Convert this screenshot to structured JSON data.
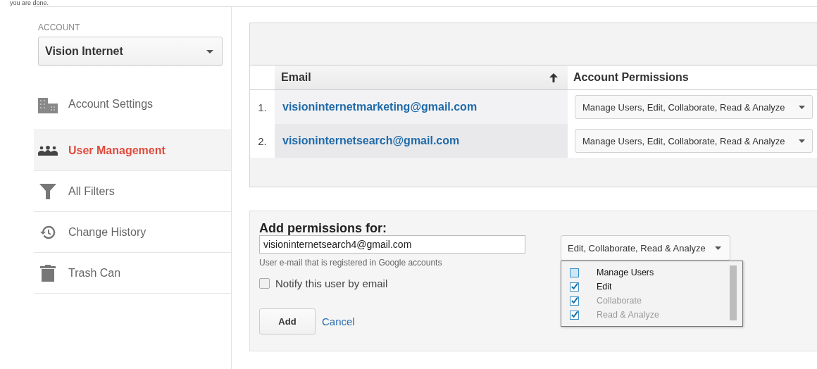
{
  "top_note": "you are done.",
  "sidebar": {
    "account_label": "ACCOUNT",
    "account": "Vision Internet",
    "items": [
      {
        "label": "Account Settings",
        "kind": "building",
        "selected": false
      },
      {
        "label": "User Management",
        "kind": "users",
        "selected": true
      },
      {
        "label": "All Filters",
        "kind": "filter",
        "selected": false
      },
      {
        "label": "Change History",
        "kind": "history",
        "selected": false
      },
      {
        "label": "Trash Can",
        "kind": "trash",
        "selected": false
      }
    ]
  },
  "table": {
    "columns": [
      "Email",
      "Account Permissions"
    ],
    "rows": [
      {
        "number": "1.",
        "email": "visioninternetmarketing@gmail.com",
        "permissions": "Manage Users, Edit, Collaborate, Read & Analyze"
      },
      {
        "number": "2.",
        "email": "visioninternetsearch@gmail.com",
        "permissions": "Manage Users, Edit, Collaborate, Read & Analyze"
      }
    ]
  },
  "add_form": {
    "title": "Add permissions for:",
    "email_value": "visioninternetsearch4@gmail.com",
    "hint": "User e-mail that is registered in Google accounts",
    "notify": {
      "label": "Notify this user by email",
      "checked": false
    },
    "add_button": "Add",
    "cancel_link": "Cancel",
    "permissions_select": "Edit, Collaborate, Read & Analyze",
    "permission_options": [
      {
        "label": "Manage Users",
        "checked": false,
        "disabled": false
      },
      {
        "label": "Edit",
        "checked": true,
        "disabled": false
      },
      {
        "label": "Collaborate",
        "checked": true,
        "disabled": true
      },
      {
        "label": "Read & Analyze",
        "checked": true,
        "disabled": true
      }
    ]
  }
}
